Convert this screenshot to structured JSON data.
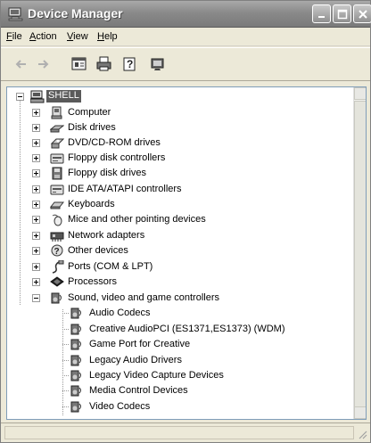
{
  "window": {
    "title": "Device Manager"
  },
  "menu": [
    {
      "id": "file",
      "label": "File",
      "mnemonic": "F",
      "rest": "ile"
    },
    {
      "id": "action",
      "label": "Action",
      "mnemonic": "A",
      "rest": "ction"
    },
    {
      "id": "view",
      "label": "View",
      "mnemonic": "V",
      "rest": "iew"
    },
    {
      "id": "help",
      "label": "Help",
      "mnemonic": "H",
      "rest": "elp"
    }
  ],
  "toolbar": [
    "back-icon",
    "forward-icon",
    "properties-icon",
    "print-icon",
    "help-icon",
    "scan-hardware-icon"
  ],
  "tree": {
    "root": "SHELL",
    "categories": [
      {
        "label": "Computer",
        "icon": "computer-icon"
      },
      {
        "label": "Disk drives",
        "icon": "disk-drive-icon"
      },
      {
        "label": "DVD/CD-ROM drives",
        "icon": "cdrom-icon"
      },
      {
        "label": "Floppy disk controllers",
        "icon": "floppy-controller-icon"
      },
      {
        "label": "Floppy disk drives",
        "icon": "floppy-drive-icon"
      },
      {
        "label": "IDE ATA/ATAPI controllers",
        "icon": "ide-controller-icon"
      },
      {
        "label": "Keyboards",
        "icon": "keyboard-icon"
      },
      {
        "label": "Mice and other pointing devices",
        "icon": "mouse-icon"
      },
      {
        "label": "Network adapters",
        "icon": "network-adapter-icon"
      },
      {
        "label": "Other devices",
        "icon": "other-devices-icon"
      },
      {
        "label": "Ports (COM & LPT)",
        "icon": "ports-icon"
      },
      {
        "label": "Processors",
        "icon": "processor-icon"
      },
      {
        "label": "Sound, video and game controllers",
        "icon": "sound-icon",
        "expanded": true
      }
    ],
    "sound_children": [
      "Audio Codecs",
      "Creative AudioPCI (ES1371,ES1373) (WDM)",
      "Game Port for Creative",
      "Legacy Audio Drivers",
      "Legacy Video Capture Devices",
      "Media Control Devices",
      "Video Codecs"
    ]
  }
}
